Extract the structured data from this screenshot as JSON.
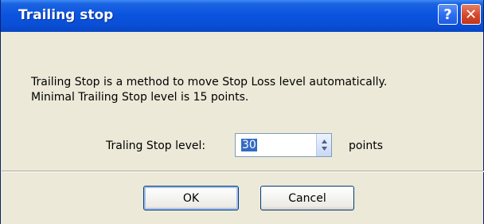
{
  "dialog": {
    "title": "Trailing stop",
    "help_label": "?",
    "close_label": "✕"
  },
  "message": {
    "line1": "Trailing Stop is a method to move Stop Loss level automatically.",
    "line2": "Minimal Trailing Stop level is 15 points."
  },
  "level": {
    "label": "Traling Stop level:",
    "value": "30",
    "unit": "points"
  },
  "buttons": {
    "ok": "OK",
    "cancel": "Cancel"
  },
  "colors": {
    "titlebar": "#0b54e0",
    "close": "#d6472a",
    "help": "#2a6cf0",
    "selection": "#316ac5",
    "dialog_bg": "#ece9d8"
  },
  "icons": {
    "help": "help-icon",
    "close": "close-icon",
    "spin": "spin-arrows-icon"
  }
}
